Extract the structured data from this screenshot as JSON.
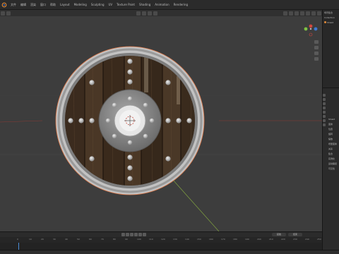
{
  "menubar": {
    "items": [
      "文件",
      "编辑",
      "渲染",
      "窗口",
      "帮助",
      "Layout",
      "Modeling",
      "Sculpting",
      "UV",
      "Texture Paint",
      "Shading",
      "Animation",
      "Rendering"
    ]
  },
  "outliner": {
    "rows": [
      "场景集合",
      "Collection",
      "Shield"
    ]
  },
  "properties": {
    "rows": [
      "Shield",
      "变换",
      "位置",
      "旋转",
      "缩放",
      "增量变换",
      "关系",
      "集合",
      "实例化",
      "运动路径",
      "可见性"
    ]
  },
  "timeline": {
    "start_field": "起始",
    "end_field": "结束",
    "ticks": [
      "0",
      "10",
      "20",
      "30",
      "40",
      "50",
      "60",
      "70",
      "80",
      "90",
      "100",
      "110",
      "120",
      "130",
      "140",
      "150",
      "160",
      "170",
      "180",
      "190",
      "200",
      "210",
      "220",
      "230",
      "240",
      "250"
    ]
  },
  "colors": {
    "viewport_bg": "#3d3d3d",
    "accent_blue": "#4b8ed8",
    "selection_orange": "#e08a3a",
    "axis_x": "#d0473f",
    "axis_y": "#7fc242",
    "axis_z": "#3e78d4"
  }
}
